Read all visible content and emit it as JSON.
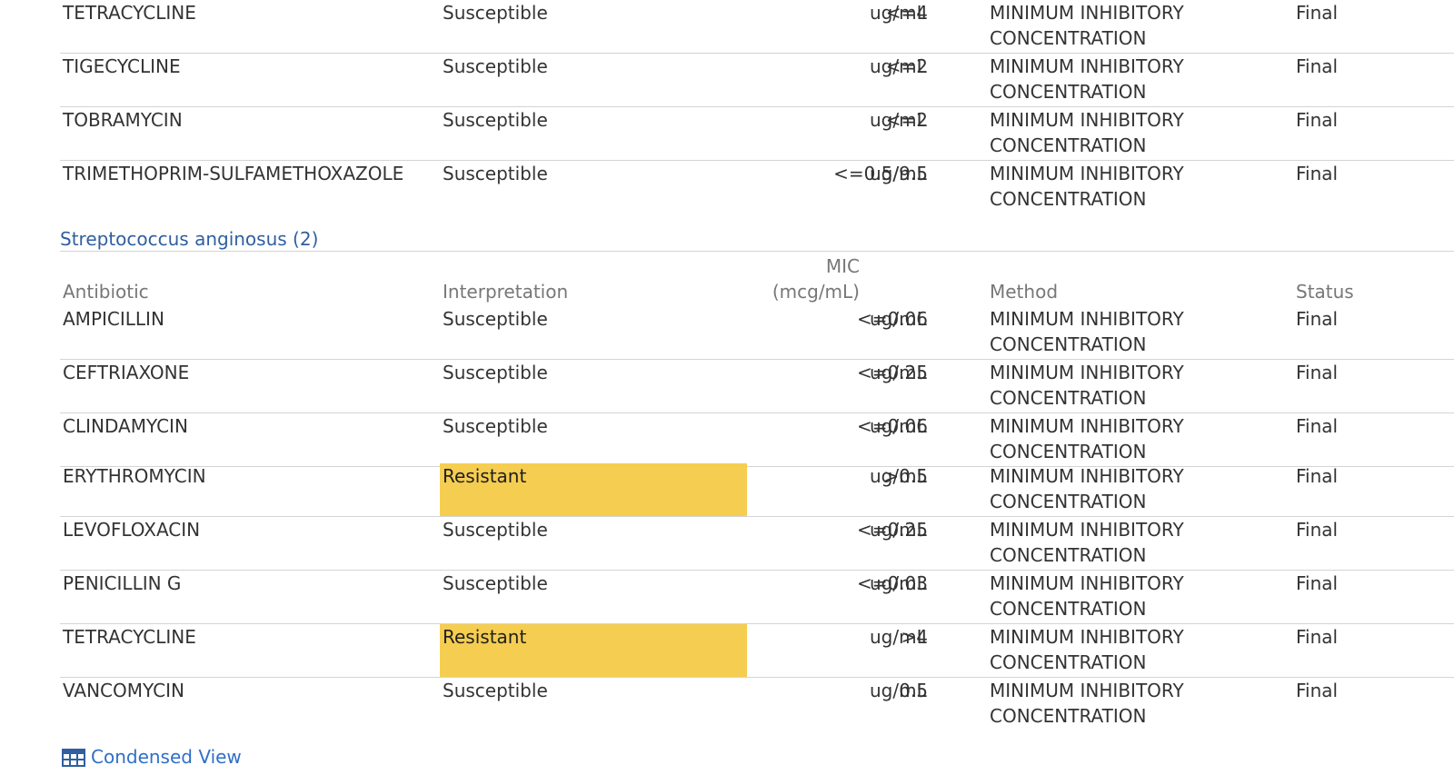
{
  "units": "ug/mL",
  "group1": {
    "rows": [
      {
        "antibiotic": "TETRACYCLINE",
        "interpretation": "Susceptible",
        "mic": "<=4",
        "method1": "MINIMUM INHIBITORY",
        "method2": "CONCENTRATION",
        "status": "Final"
      },
      {
        "antibiotic": "TIGECYCLINE",
        "interpretation": "Susceptible",
        "mic": "<=2",
        "method1": "MINIMUM INHIBITORY",
        "method2": "CONCENTRATION",
        "status": "Final"
      },
      {
        "antibiotic": "TOBRAMYCIN",
        "interpretation": "Susceptible",
        "mic": "<=2",
        "method1": "MINIMUM INHIBITORY",
        "method2": "CONCENTRATION",
        "status": "Final"
      },
      {
        "antibiotic": "TRIMETHOPRIM-SULFAMETHOXAZOLE",
        "interpretation": "Susceptible",
        "mic": "<=0.5/9.5",
        "method1": "MINIMUM INHIBITORY",
        "method2": "CONCENTRATION",
        "status": "Final"
      }
    ]
  },
  "group2": {
    "title": "Streptococcus anginosus (2)",
    "headers": {
      "antibiotic": "Antibiotic",
      "interpretation": "Interpretation",
      "mic_line1": "MIC",
      "mic_line2": "(mcg/mL)",
      "method": "Method",
      "status": "Status"
    },
    "rows": [
      {
        "antibiotic": "AMPICILLIN",
        "interpretation": "Susceptible",
        "mic": "<=0.06",
        "method1": "MINIMUM INHIBITORY",
        "method2": "CONCENTRATION",
        "status": "Final"
      },
      {
        "antibiotic": "CEFTRIAXONE",
        "interpretation": "Susceptible",
        "mic": "<=0.25",
        "method1": "MINIMUM INHIBITORY",
        "method2": "CONCENTRATION",
        "status": "Final"
      },
      {
        "antibiotic": "CLINDAMYCIN",
        "interpretation": "Susceptible",
        "mic": "<=0.06",
        "method1": "MINIMUM INHIBITORY",
        "method2": "CONCENTRATION",
        "status": "Final"
      },
      {
        "antibiotic": "ERYTHROMYCIN",
        "interpretation": "Resistant",
        "mic": ">0.5",
        "method1": "MINIMUM INHIBITORY",
        "method2": "CONCENTRATION",
        "status": "Final"
      },
      {
        "antibiotic": "LEVOFLOXACIN",
        "interpretation": "Susceptible",
        "mic": "<=0.25",
        "method1": "MINIMUM INHIBITORY",
        "method2": "CONCENTRATION",
        "status": "Final"
      },
      {
        "antibiotic": "PENICILLIN G",
        "interpretation": "Susceptible",
        "mic": "<=0.03",
        "method1": "MINIMUM INHIBITORY",
        "method2": "CONCENTRATION",
        "status": "Final"
      },
      {
        "antibiotic": "TETRACYCLINE",
        "interpretation": "Resistant",
        "mic": ">4",
        "method1": "MINIMUM INHIBITORY",
        "method2": "CONCENTRATION",
        "status": "Final"
      },
      {
        "antibiotic": "VANCOMYCIN",
        "interpretation": "Susceptible",
        "mic": "0.5",
        "method1": "MINIMUM INHIBITORY",
        "method2": "CONCENTRATION",
        "status": "Final"
      }
    ]
  },
  "footer": {
    "condensed_view_label": "Condensed View",
    "icon": "table-grid-icon"
  },
  "colors": {
    "resistant_highlight": "#f5cd50",
    "organism_title": "#2f5fa0",
    "link": "#2f6fc8"
  }
}
